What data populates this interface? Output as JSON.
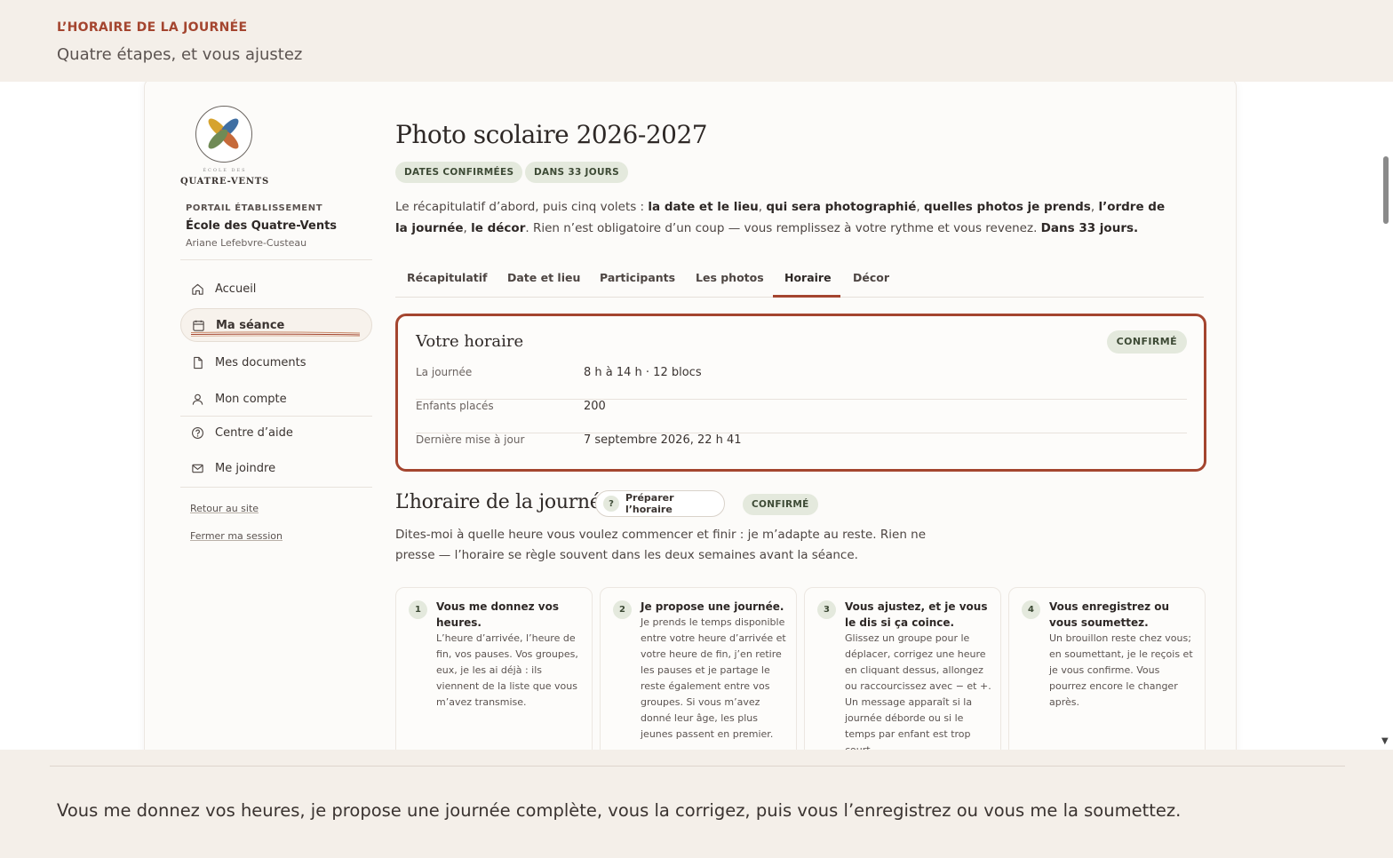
{
  "slide": {
    "eyebrow": "L’HORAIRE DE LA JOURNÉE",
    "subline": "Quatre étapes, et vous ajustez",
    "caption": "Vous me donnez vos heures, je propose une journée complète, vous la corrigez, puis vous l’enregistrez ou vous me la soumettez."
  },
  "sidebar": {
    "logo_small": "ÉCOLE DES",
    "logo_name": "QUATRE-VENTS",
    "portal_label": "PORTAIL ÉTABLISSEMENT",
    "school": "École des Quatre-Vents",
    "user": "Ariane Lefebvre-Custeau",
    "nav": [
      {
        "label": "Accueil",
        "icon": "home-icon"
      },
      {
        "label": "Ma séance",
        "icon": "calendar-icon",
        "active": true
      },
      {
        "label": "Mes documents",
        "icon": "document-icon"
      },
      {
        "label": "Mon compte",
        "icon": "user-icon"
      },
      {
        "label": "Centre d’aide",
        "icon": "help-icon"
      },
      {
        "label": "Me joindre",
        "icon": "mail-icon"
      }
    ],
    "links": [
      "Retour au site",
      "Fermer ma session"
    ]
  },
  "main": {
    "title": "Photo scolaire 2026-2027",
    "badges": [
      "DATES CONFIRMÉES",
      "DANS 33 JOURS"
    ],
    "intro": {
      "t1": "Le récapitulatif d’abord, puis cinq volets : ",
      "b1": "la date et le lieu",
      "t2": ", ",
      "b2": "qui sera photographié",
      "t3": ", ",
      "b3": "quelles photos je prends",
      "t4": ", ",
      "b4": "l’ordre de la journée",
      "t5": ", ",
      "b5": "le décor",
      "t6": ". Rien n’est obligatoire d’un coup — vous remplissez à votre rythme et vous revenez. ",
      "b6": "Dans 33 jours."
    },
    "tabs": [
      "Récapitulatif",
      "Date et lieu",
      "Participants",
      "Les photos",
      "Horaire",
      "Décor"
    ],
    "active_tab": "Horaire"
  },
  "schedule": {
    "title": "Votre horaire",
    "badge": "CONFIRMÉ",
    "rows": [
      {
        "label": "La journée",
        "value": "8 h à 14 h · 12 blocs"
      },
      {
        "label": "Enfants placés",
        "value": "200"
      },
      {
        "label": "Dernière mise à jour",
        "value": "7 septembre 2026, 22 h 41"
      }
    ]
  },
  "section": {
    "title": "L’horaire de la journée",
    "prep_button": "Préparer l’horaire",
    "prep_icon": "?",
    "badge": "CONFIRMÉ",
    "desc": "Dites-moi à quelle heure vous voulez commencer et finir : je m’adapte au reste. Rien ne presse — l’horaire se règle souvent dans les deux semaines avant la séance."
  },
  "steps": [
    {
      "num": "1",
      "title": "Vous me donnez vos heures.",
      "text": "L’heure d’arrivée, l’heure de fin, vos pauses. Vos groupes, eux, je les ai déjà : ils viennent de la liste que vous m’avez transmise."
    },
    {
      "num": "2",
      "title": "Je propose une journée.",
      "text": "Je prends le temps disponible entre votre heure d’arrivée et votre heure de fin, j’en retire les pauses et je partage le reste également entre vos groupes. Si vous m’avez donné leur âge, les plus jeunes passent en premier."
    },
    {
      "num": "3",
      "title": "Vous ajustez, et je vous le dis si ça coince.",
      "text": "Glissez un groupe pour le déplacer, corrigez une heure en cliquant dessus, allongez ou raccourcissez avec − et +. Un message apparaît si la journée déborde ou si le temps par enfant est trop court."
    },
    {
      "num": "4",
      "title": "Vous enregistrez ou vous soumettez.",
      "text": "Un brouillon reste chez vous; en soumettant, je le reçois et je vous confirme. Vous pourrez encore le changer après."
    }
  ],
  "colors": {
    "accent": "#a4452f",
    "badge_bg": "#e4e9dd",
    "badge_text": "#3d4a35",
    "band": "#f4efe9"
  }
}
